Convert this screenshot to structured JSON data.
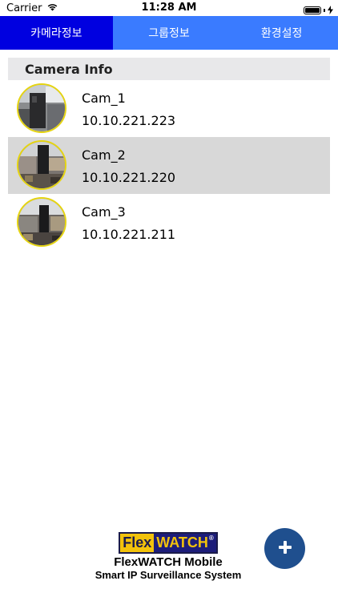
{
  "status_bar": {
    "carrier": "Carrier",
    "time": "11:28 AM",
    "battery_level": 1.0
  },
  "tabs": [
    {
      "label": "카메라정보",
      "active": true
    },
    {
      "label": "그룹정보",
      "active": false
    },
    {
      "label": "환경설정",
      "active": false
    }
  ],
  "section": {
    "title": "Camera Info"
  },
  "cameras": [
    {
      "name": "Cam_1",
      "ip": "10.10.221.223",
      "selected": false
    },
    {
      "name": "Cam_2",
      "ip": "10.10.221.220",
      "selected": true
    },
    {
      "name": "Cam_3",
      "ip": "10.10.221.211",
      "selected": false
    }
  ],
  "brand": {
    "logo_part1": "Flex",
    "logo_part2": "WATCH",
    "logo_mark": "®",
    "title": "FlexWATCH Mobile",
    "subtitle": "Smart IP Surveillance System"
  },
  "fab": {
    "icon": "plus-icon",
    "label": "+"
  },
  "colors": {
    "tab_active": "#0000e0",
    "tab_inactive": "#3a7bff",
    "selected_row": "#d8d8d8",
    "thumb_border": "#e5d410",
    "fab": "#1f4f8e"
  }
}
